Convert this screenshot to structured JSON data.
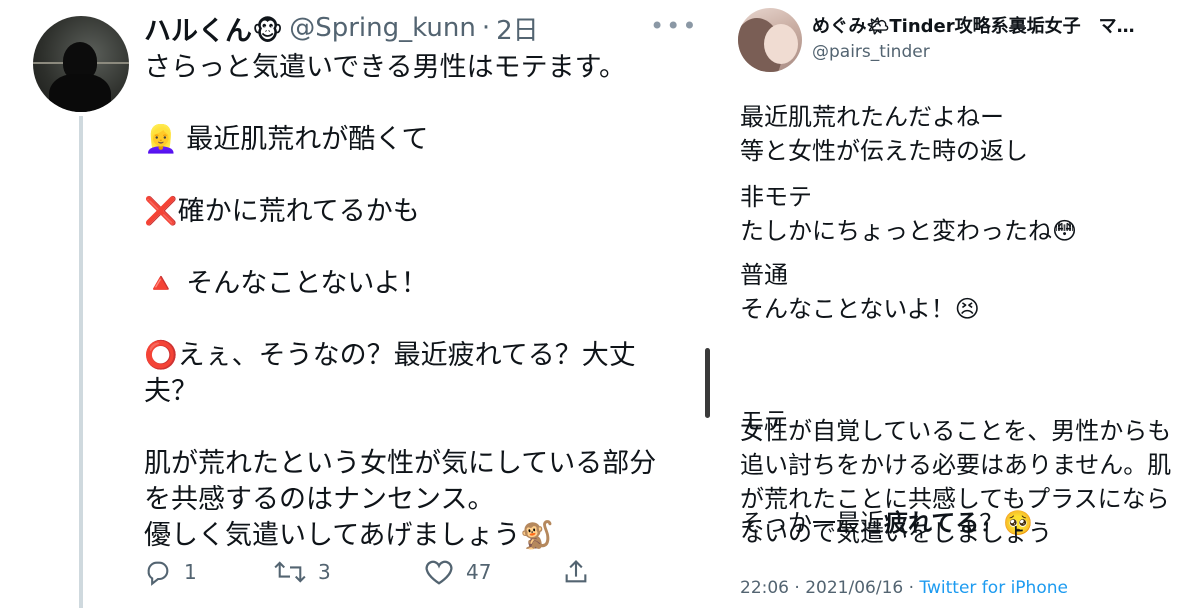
{
  "left_tweet": {
    "display_name": "ハルくん🐵",
    "handle": "@Spring_kunn",
    "separator": "·",
    "time": "2日",
    "more_icon": "more-icon",
    "text": "さらっと気遣いできる男性はモテます。\n\n👱‍♀️ 最近肌荒れが酷くて\n\n❌確かに荒れてるかも\n\n🔺 そんなことないよ！\n\n⭕️えぇ、そうなの？最近疲れてる？大丈夫？\n\n肌が荒れたという女性が気にしている部分を共感するのはナンセンス。\n優しく気遣いしてあげましょう🐒",
    "replies": "1",
    "retweets": "3",
    "likes": "47",
    "icons": [
      "reply-icon",
      "retweet-icon",
      "like-icon",
      "share-icon"
    ]
  },
  "right_tweet": {
    "display_name": "めぐみ🌤Tinder攻略系裏垢女子　マ…",
    "handle": "@pairs_tinder",
    "block1": "最近肌荒れたんだよねー\n等と女性が伝えた時の返し",
    "block2": "非モテ\nたしかにちょっと変わったね😳",
    "block3": "普通\nそんなことないよ！😣",
    "block4_label": "モテ",
    "block4_prefix": "そっか一最近",
    "block4_bold": "疲れてる",
    "block4_suffix": "？🥺",
    "block5": "女性が自覚していることを、男性からも追い討ちをかける必要はありません。肌が荒れたことに共感してもプラスにならないので気遣いをしましょう",
    "time": "22:06",
    "date": "2021/06/16",
    "sep": "·",
    "source": "Twitter for iPhone"
  }
}
